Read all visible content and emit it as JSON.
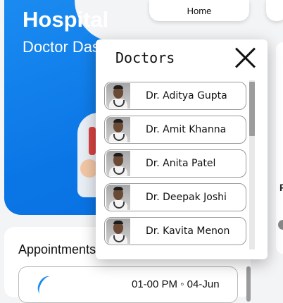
{
  "hero": {
    "title": "Hospital",
    "subtitle": "Doctor Dashboard"
  },
  "nav": {
    "home_label": "Home"
  },
  "side": {
    "letter": "F"
  },
  "appointments": {
    "title": "Appointments",
    "first_time": "01-00 PM ◦ 04-Jun"
  },
  "dialog": {
    "title": "Doctors",
    "doctors": [
      {
        "name": "Dr. Aditya Gupta"
      },
      {
        "name": "Dr. Amit Khanna"
      },
      {
        "name": "Dr. Anita Patel"
      },
      {
        "name": "Dr. Deepak Joshi"
      },
      {
        "name": "Dr. Kavita Menon"
      }
    ],
    "scroll_position": 0.0,
    "visible_fraction": 0.32
  }
}
